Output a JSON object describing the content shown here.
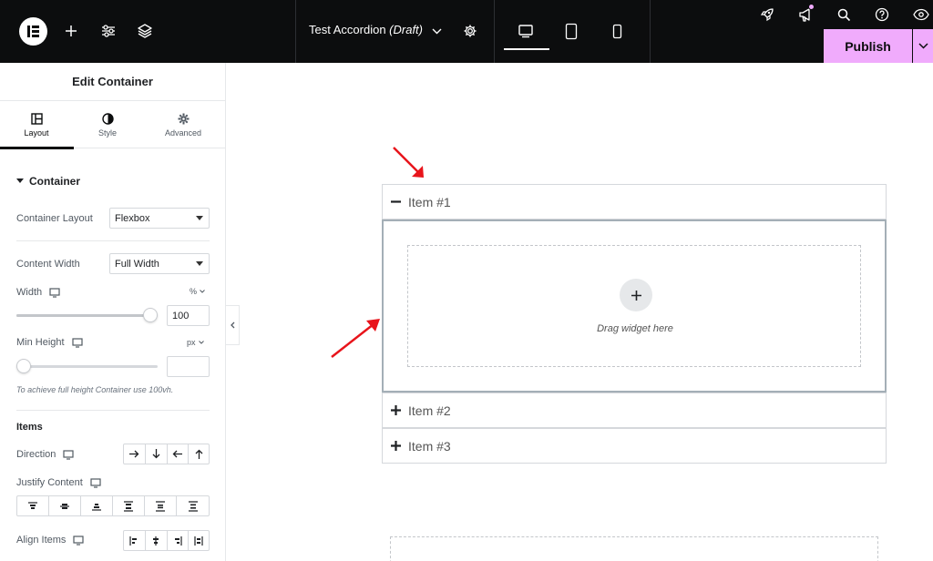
{
  "topbar": {
    "logo_icon": "elementor-logo-icon",
    "icons_left": [
      "plus-icon",
      "sliders-icon",
      "layers-icon"
    ],
    "document_title": "Test Accordion",
    "document_status": "(Draft)",
    "devices": [
      "desktop-icon",
      "tablet-icon",
      "mobile-icon"
    ],
    "active_device": "desktop",
    "icons_right": [
      "rocket-icon",
      "megaphone-icon",
      "search-icon",
      "help-icon",
      "eye-icon"
    ],
    "publish_label": "Publish",
    "accent_color": "#f0abfc"
  },
  "panel": {
    "title": "Edit Container",
    "tabs": [
      {
        "label": "Layout",
        "icon": "layout-icon",
        "active": true
      },
      {
        "label": "Style",
        "icon": "contrast-icon",
        "active": false
      },
      {
        "label": "Advanced",
        "icon": "gear-icon",
        "active": false
      }
    ],
    "section_title": "Container",
    "container_layout": {
      "label": "Container Layout",
      "value": "Flexbox"
    },
    "content_width": {
      "label": "Content Width",
      "value": "Full Width"
    },
    "width": {
      "label": "Width",
      "unit": "%",
      "value": "100",
      "slider_fraction": 1.0
    },
    "min_height": {
      "label": "Min Height",
      "unit": "px",
      "value": "",
      "slider_fraction": 0.0
    },
    "hint": "To achieve full height Container use 100vh.",
    "items_title": "Items",
    "direction": {
      "label": "Direction",
      "options": [
        "arrow-right-icon",
        "arrow-down-icon",
        "arrow-left-icon",
        "arrow-up-icon"
      ]
    },
    "justify_content": {
      "label": "Justify Content",
      "options": [
        "justify-start-icon",
        "justify-center-icon",
        "justify-end-icon",
        "justify-space-between-icon",
        "justify-space-around-icon",
        "justify-space-evenly-icon"
      ]
    },
    "align_items": {
      "label": "Align Items",
      "options": [
        "align-start-icon",
        "align-center-icon",
        "align-end-icon",
        "align-stretch-icon"
      ]
    }
  },
  "canvas": {
    "accordion_items": [
      {
        "title": "Item #1",
        "expanded": true
      },
      {
        "title": "Item #2",
        "expanded": false
      },
      {
        "title": "Item #3",
        "expanded": false
      }
    ],
    "dropzone_text": "Drag widget here",
    "annotation_color": "#e8141b"
  }
}
